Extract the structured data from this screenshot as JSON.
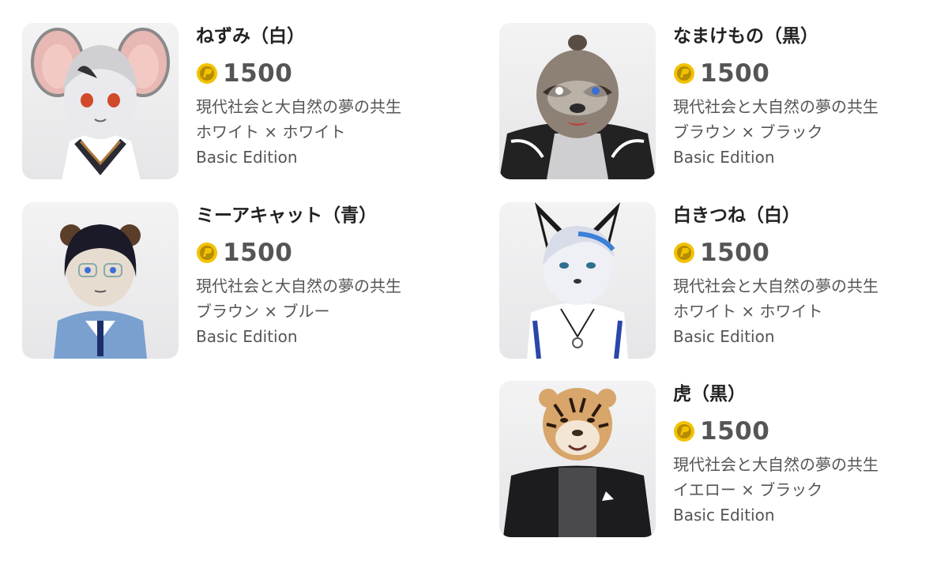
{
  "products": [
    {
      "name": "ねずみ（白）",
      "price": "1500",
      "desc": "現代社会と大自然の夢の共生",
      "colors": "ホワイト × ホワイト",
      "edition": "Basic Edition",
      "avatar": "mouse-avatar-icon"
    },
    {
      "name": "なまけもの（黒）",
      "price": "1500",
      "desc": "現代社会と大自然の夢の共生",
      "colors": "ブラウン × ブラック",
      "edition": "Basic Edition",
      "avatar": "sloth-avatar-icon"
    },
    {
      "name": "ミーアキャット（青）",
      "price": "1500",
      "desc": "現代社会と大自然の夢の共生",
      "colors": "ブラウン × ブルー",
      "edition": "Basic Edition",
      "avatar": "meerkat-avatar-icon"
    },
    {
      "name": "白きつね（白）",
      "price": "1500",
      "desc": "現代社会と大自然の夢の共生",
      "colors": "ホワイト × ホワイト",
      "edition": "Basic Edition",
      "avatar": "fox-avatar-icon"
    },
    {
      "name": "虎（黒）",
      "price": "1500",
      "desc": "現代社会と大自然の夢の共生",
      "colors": "イエロー × ブラック",
      "edition": "Basic Edition",
      "avatar": "tiger-avatar-icon"
    }
  ],
  "coin_icon": "coin-icon",
  "colors": {
    "coin": "#f2c200",
    "coin_dark": "#b58c00",
    "price_text": "#555555",
    "name_text": "#222222"
  }
}
